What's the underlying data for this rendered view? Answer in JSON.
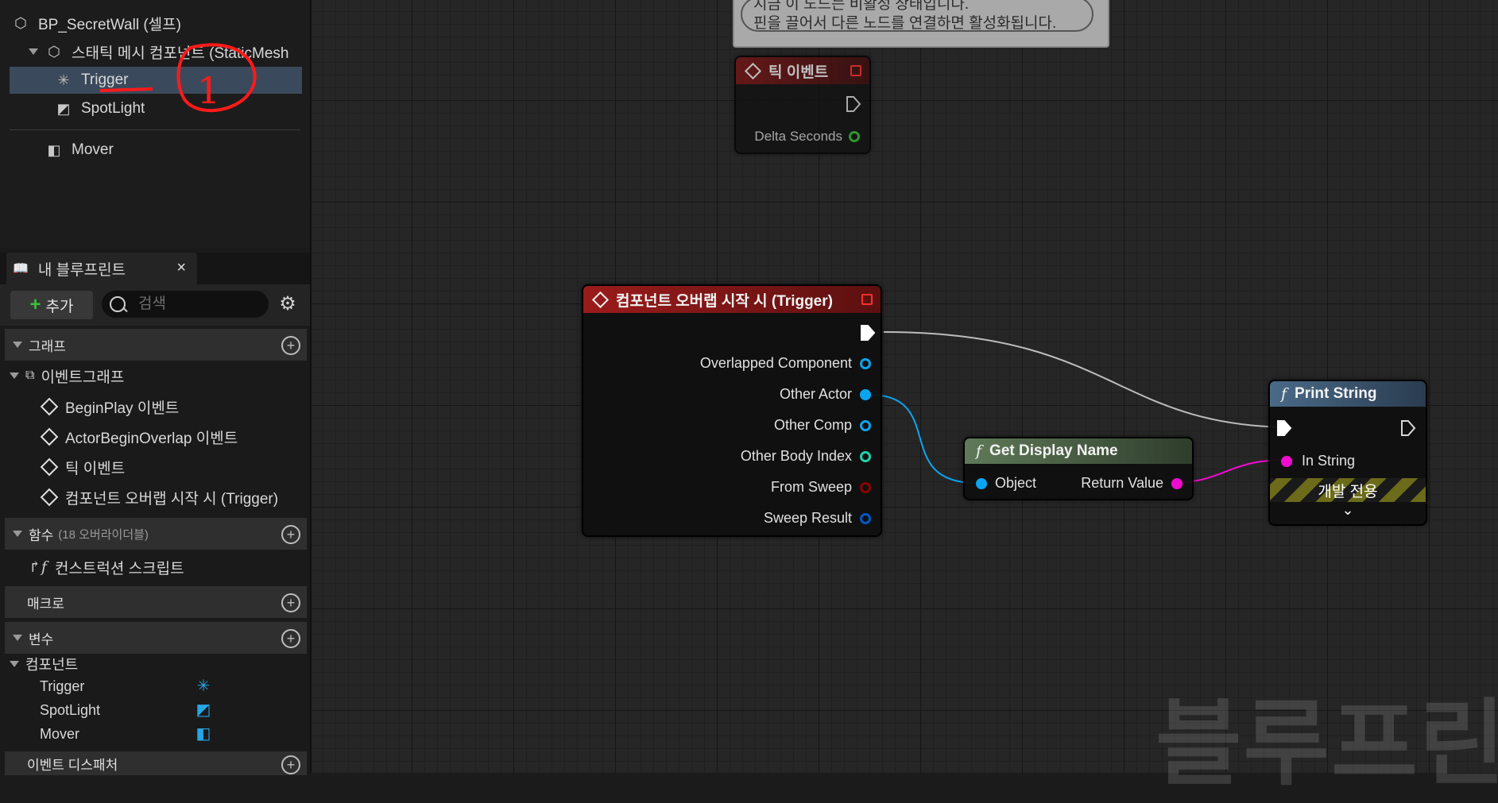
{
  "components": {
    "root": "BP_SecretWall (셀프)",
    "static_mesh": "스태틱 메시 컴포넌트 (StaticMesh",
    "trigger": "Trigger",
    "spotlight": "SpotLight",
    "mover": "Mover",
    "annotation": "1"
  },
  "my_blueprint": {
    "tab": "내 블루프린트",
    "add_label": "추가",
    "search_placeholder": "검색",
    "sections": {
      "graph": "그래프",
      "functions": "함수",
      "functions_count": "(18 오버라이더블)",
      "macros": "매크로",
      "variables": "변수",
      "dispatchers": "이벤트 디스패처"
    },
    "event_graph": "이벤트그래프",
    "events": [
      "BeginPlay 이벤트",
      "ActorBeginOverlap 이벤트",
      "틱 이벤트",
      "컴포넌트 오버랩 시작 시 (Trigger)"
    ],
    "construction_script": "컨스트럭션 스크립트",
    "var_category": "컴포넌트",
    "variables": [
      "Trigger",
      "SpotLight",
      "Mover"
    ]
  },
  "graph": {
    "comment": [
      "지금 이 노드는 비활성 상태입니다.",
      "핀을 끌어서 다른 노드를 연결하면 활성화됩니다."
    ],
    "tick_node": {
      "title": "틱 이벤트",
      "pin": "Delta Seconds"
    },
    "overlap_node": {
      "title": "컴포넌트 오버랩 시작 시 (Trigger)",
      "pins": [
        "Overlapped Component",
        "Other Actor",
        "Other Comp",
        "Other Body Index",
        "From Sweep",
        "Sweep Result"
      ]
    },
    "display_name_node": {
      "title": "Get Display Name",
      "in": "Object",
      "out": "Return Value"
    },
    "print_node": {
      "title": "Print String",
      "pin": "In String",
      "dev_only": "개발 전용"
    },
    "watermark": "블루프린트"
  },
  "colors": {
    "event_header": "#8b1a1a",
    "pure_header": "#5f7a58",
    "function_header": "#4a6a88",
    "object_pin": "#0aa5ef",
    "string_pin": "#f00bd0",
    "float_pin": "#2fbf2f",
    "int_pin": "#1fd2ac",
    "bool_pin": "#8c0000",
    "struct_pin": "#0058c8",
    "selection": "#3a4a5c"
  }
}
